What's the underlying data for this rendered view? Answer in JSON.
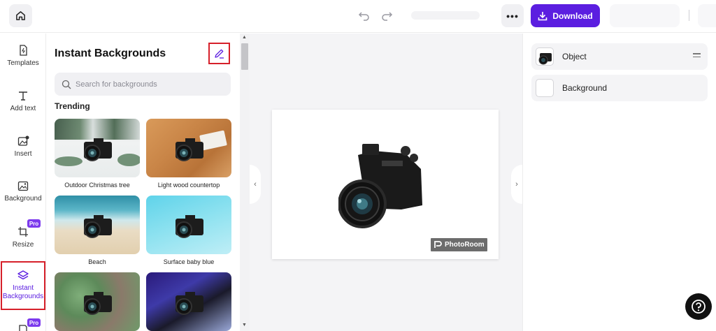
{
  "topbar": {
    "download_label": "Download",
    "more_label": "•••"
  },
  "rail": {
    "items": [
      {
        "label": "Templates",
        "icon": "templates-icon"
      },
      {
        "label": "Add text",
        "icon": "text-icon"
      },
      {
        "label": "Insert",
        "icon": "insert-image-icon"
      },
      {
        "label": "Background",
        "icon": "background-icon"
      },
      {
        "label": "Resize",
        "icon": "crop-icon",
        "badge": "Pro"
      },
      {
        "label": "Instant Backgrounds",
        "icon": "layers-icon",
        "active": true
      },
      {
        "label": "",
        "icon": "partial-icon",
        "badge": "Pro"
      }
    ]
  },
  "panel": {
    "title": "Instant Backgrounds",
    "search_placeholder": "Search for backgrounds",
    "section": "Trending",
    "thumbnails": [
      {
        "label": "Outdoor Christmas tree"
      },
      {
        "label": "Light wood countertop"
      },
      {
        "label": "Beach"
      },
      {
        "label": "Surface baby blue"
      },
      {
        "label": ""
      },
      {
        "label": ""
      }
    ]
  },
  "canvas": {
    "watermark": "PhotoRoom"
  },
  "layers": [
    {
      "label": "Object"
    },
    {
      "label": "Background"
    }
  ],
  "colors": {
    "accent": "#5b1ee0",
    "pro_badge": "#7c3aed",
    "highlight_border": "#d6202a"
  }
}
